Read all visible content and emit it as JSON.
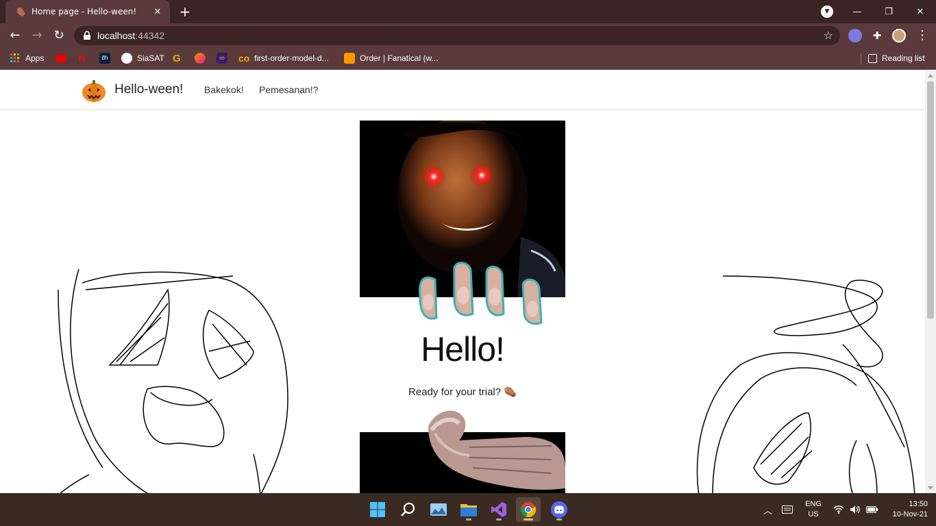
{
  "browser": {
    "tab_title": "Home page - Hello-ween!",
    "tab_close": "✕",
    "new_tab": "+",
    "url_host": "localhost",
    "url_port": ":44342",
    "window_controls": {
      "minimize": "—",
      "maximize": "❐",
      "close": "✕"
    }
  },
  "bookmarks": {
    "items": [
      {
        "label": "Apps",
        "icon": "apps-grid-icon"
      },
      {
        "label": "",
        "icon": "youtube-icon"
      },
      {
        "label": "",
        "icon": "netflix-icon"
      },
      {
        "label": "",
        "icon": "dh-icon"
      },
      {
        "label": "SiaSAT",
        "icon": "globe-icon"
      },
      {
        "label": "",
        "icon": "grammarly-icon"
      },
      {
        "label": "",
        "icon": "firefox-icon"
      },
      {
        "label": "",
        "icon": "infinity-icon"
      },
      {
        "label": "first-order-model-d...",
        "icon": "colab-icon"
      },
      {
        "label": "Order | Fanatical (w...",
        "icon": "fanatical-icon"
      }
    ],
    "reading_list": "Reading list"
  },
  "site": {
    "brand": "Hello-ween!",
    "nav": [
      "Bakekok!",
      "Pemesanan!?"
    ],
    "hero_title": "Hello!",
    "hero_subtitle": "Ready for your trial? ⚰️"
  },
  "taskbar": {
    "lang_top": "ENG",
    "lang_bottom": "US",
    "time": "13:50",
    "date": "10-Nov-21"
  },
  "colors": {
    "chrome_dark": "#3a2424",
    "chrome_mid": "#5a3a3a",
    "taskbar": "#3b2a21"
  }
}
